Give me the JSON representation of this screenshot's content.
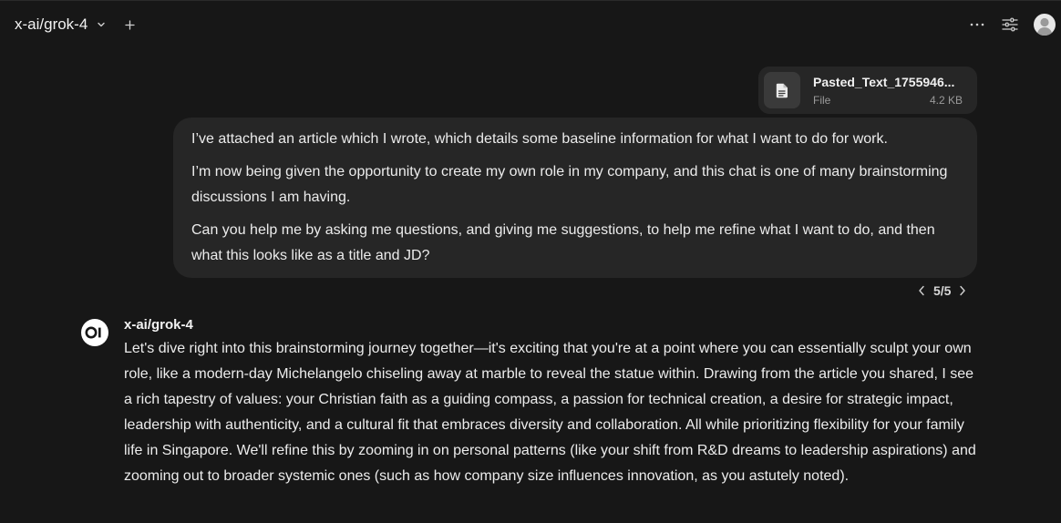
{
  "header": {
    "model_name": "x-ai/grok-4",
    "icons": {
      "model_dropdown": "chevron-down-icon",
      "new_chat": "plus-icon",
      "more": "more-horizontal-icon",
      "controls": "sliders-icon",
      "profile": "user-avatar-icon"
    }
  },
  "attachment": {
    "name": "Pasted_Text_1755946...",
    "type": "File",
    "size": "4.2 KB",
    "icon": "document-icon"
  },
  "user_message": {
    "paragraphs": [
      "I’ve attached an article which I wrote, which details some baseline information for what I want to do for work.",
      "I’m now being given the opportunity to create my own role in my company, and this chat is one of many brainstorming discussions I am having.",
      "Can you help me by asking me questions, and giving me suggestions, to help me refine what I want to do, and then what this looks like as a title and JD?"
    ]
  },
  "pager": {
    "label": "5/5"
  },
  "assistant": {
    "logo_text": "OI",
    "name": "x-ai/grok-4",
    "text": "Let's dive right into this brainstorming journey together—it's exciting that you're at a point where you can essentially sculpt your own role, like a modern-day Michelangelo chiseling away at marble to reveal the statue within. Drawing from the article you shared, I see a rich tapestry of values: your Christian faith as a guiding compass, a passion for technical creation, a desire for strategic impact, leadership with authenticity, and a cultural fit that embraces diversity and collaboration. All while prioritizing flexibility for your family life in Singapore. We'll refine this by zooming in on personal patterns (like your shift from R&D dreams to leadership aspirations) and zooming out to broader systemic ones (such as how company size influences innovation, as you astutely noted)."
  },
  "colors": {
    "background": "#171717",
    "bubble": "#262626",
    "text": "#ececec",
    "muted": "#9a9a9a"
  }
}
